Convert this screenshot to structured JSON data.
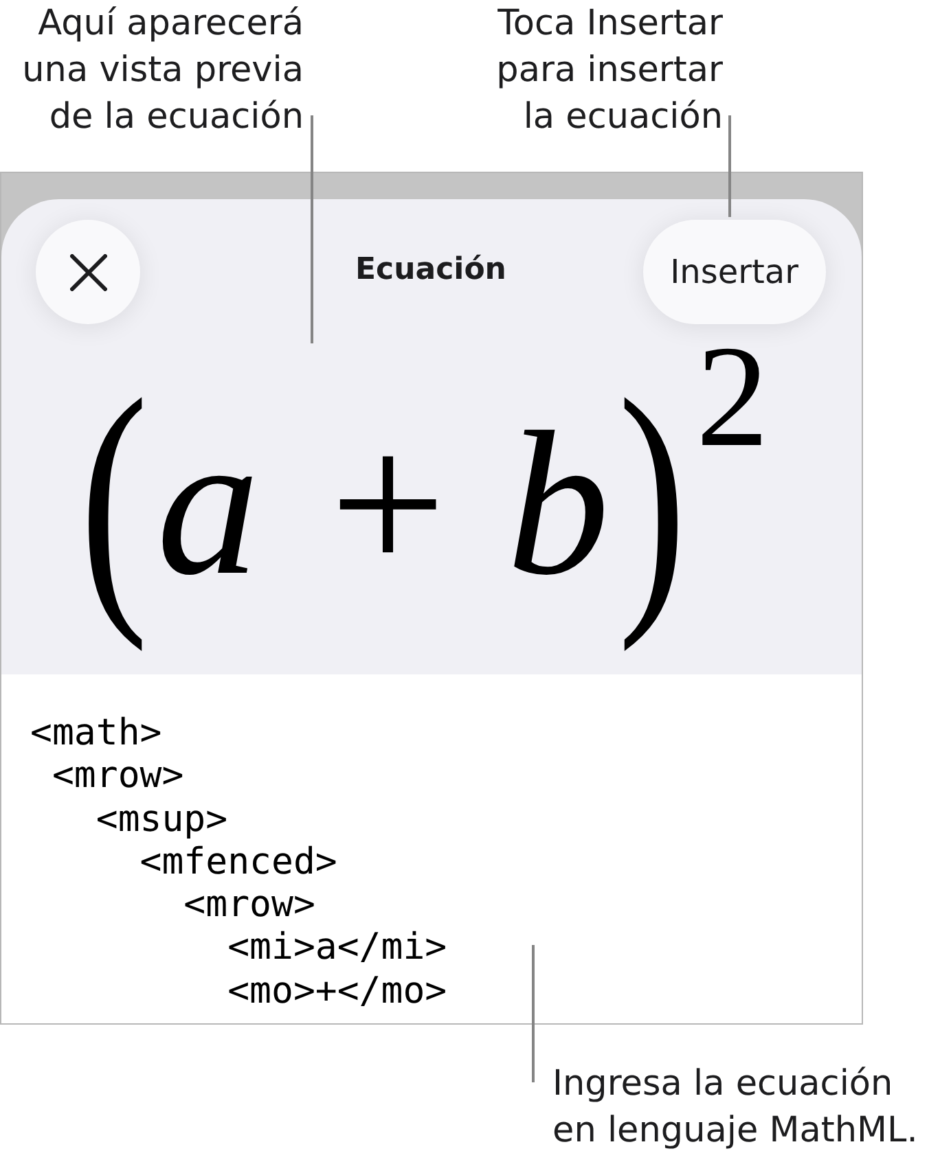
{
  "callouts_top": [
    {
      "text": "Aquí aparecerá\nuna vista previa\nde la ecuación"
    },
    {
      "text": "Toca Insertar\npara insertar\nla ecuación"
    }
  ],
  "sheet": {
    "title": "Ecuación",
    "insert_button": "Insertar"
  },
  "preview": {
    "parts": [
      {
        "kind": "fence",
        "text": "("
      },
      {
        "kind": "identifier",
        "text": "a"
      },
      {
        "kind": "operator",
        "text": "+"
      },
      {
        "kind": "identifier",
        "text": "b"
      },
      {
        "kind": "fence",
        "text": ")"
      },
      {
        "kind": "superscript",
        "text": "2"
      }
    ]
  },
  "mathml_input": {
    "lines": [
      {
        "text": "<math>",
        "children": [
          {
            "text": "<mrow>",
            "children": [
              {
                "text": "<msup>",
                "children": [
                  {
                    "text": "<mfenced>",
                    "children": [
                      {
                        "text": "<mrow>",
                        "children": [
                          {
                            "text": "<mi>a</mi>"
                          },
                          {
                            "text": "<mo>+</mo>"
                          }
                        ]
                      }
                    ]
                  }
                ]
              }
            ]
          }
        ]
      }
    ]
  },
  "callout_bottom": {
    "text": "Ingresa la ecuación\nen lenguaje MathML."
  }
}
